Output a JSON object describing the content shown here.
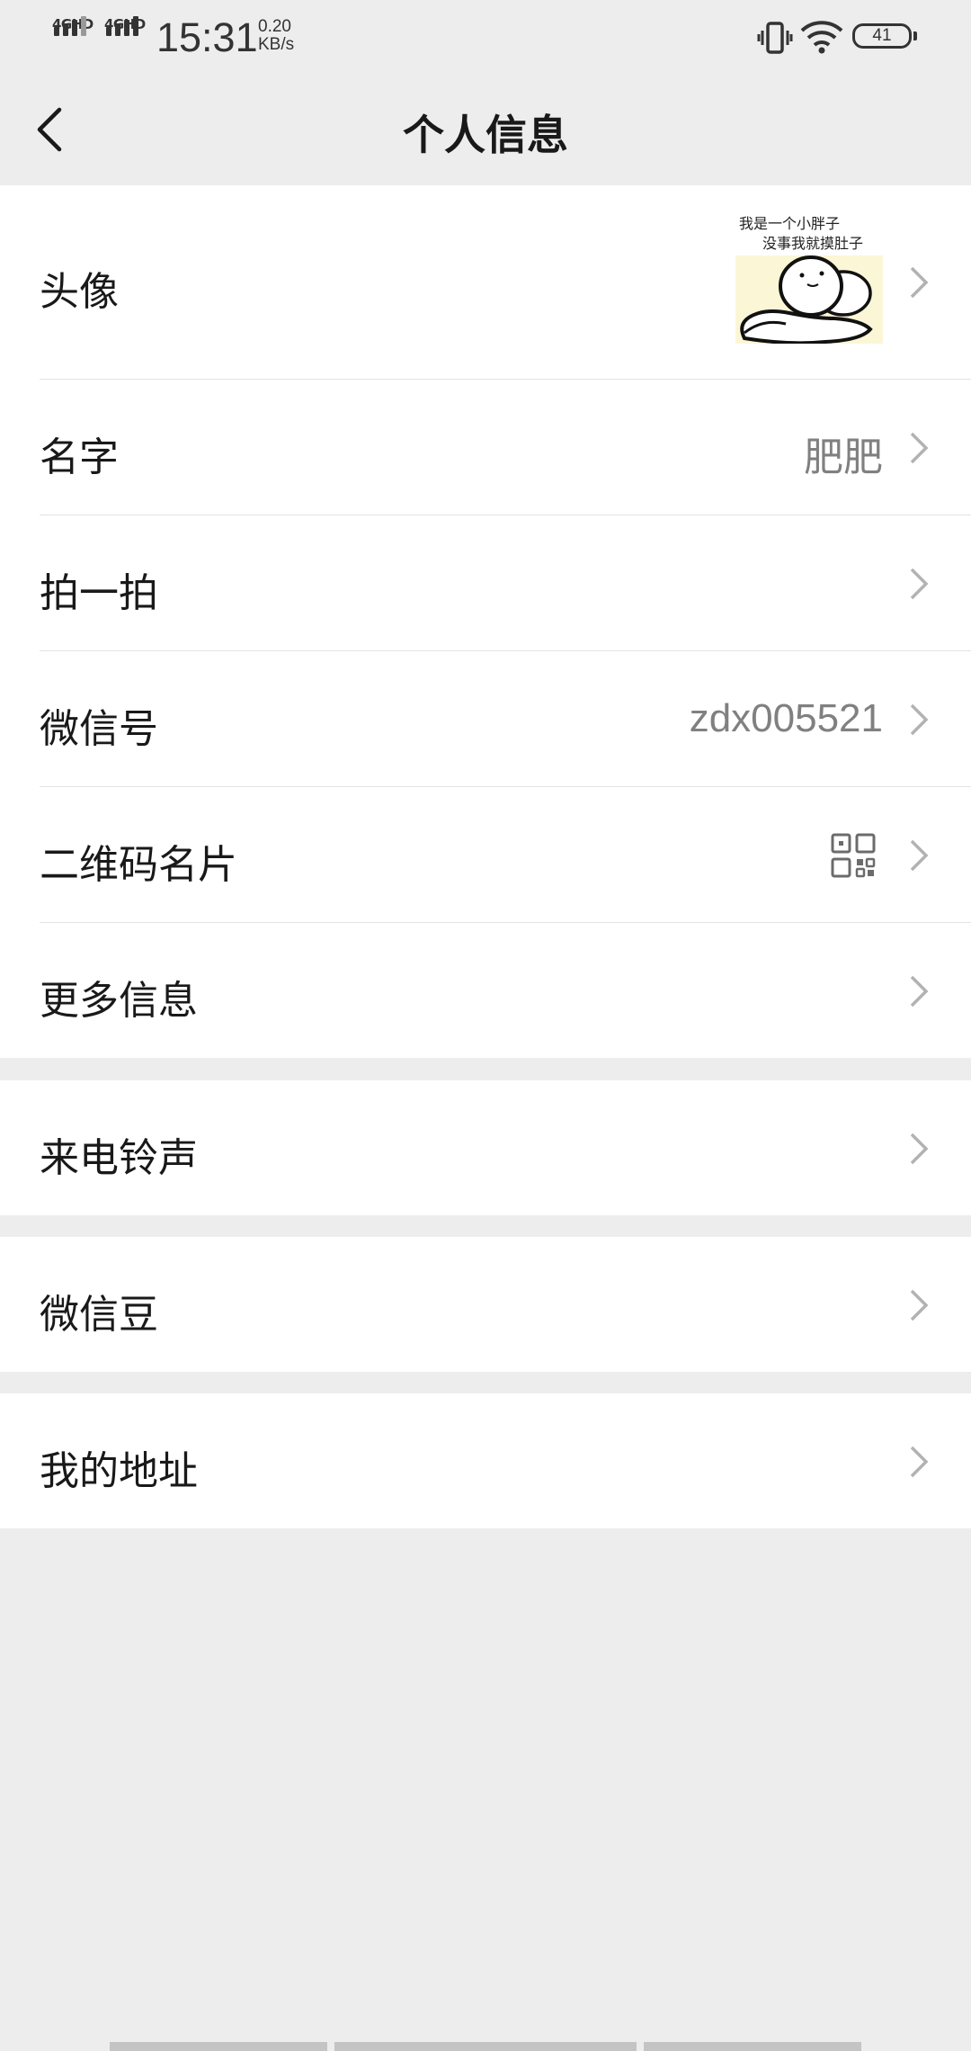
{
  "status_bar": {
    "sim1": "4GHD",
    "sim2": "4GHD",
    "time": "15:31",
    "speed_value": "0.20",
    "speed_unit": "KB/s",
    "battery": "41",
    "icons": [
      "vibrate-icon",
      "wifi-icon",
      "battery-icon"
    ]
  },
  "nav": {
    "title": "个人信息",
    "back_icon": "chevron-left-icon"
  },
  "profile_group": {
    "items": [
      {
        "label": "头像",
        "type": "avatar",
        "avatar_caption_line1": "我是一个小胖子",
        "avatar_caption_line2": "没事我就摸肚子"
      },
      {
        "label": "名字",
        "value": "肥肥"
      },
      {
        "label": "拍一拍",
        "value": ""
      },
      {
        "label": "微信号",
        "value": "zdx005521"
      },
      {
        "label": "二维码名片",
        "type": "qr",
        "icon": "qr-code-icon"
      },
      {
        "label": "更多信息",
        "value": ""
      }
    ]
  },
  "ringtone_group": {
    "label": "来电铃声"
  },
  "beans_group": {
    "label": "微信豆"
  },
  "address_group": {
    "label": "我的地址"
  },
  "colors": {
    "background": "#ededed",
    "card": "#ffffff",
    "text": "#191919",
    "secondary_text": "#808080",
    "chevron": "#b2b2b2"
  }
}
